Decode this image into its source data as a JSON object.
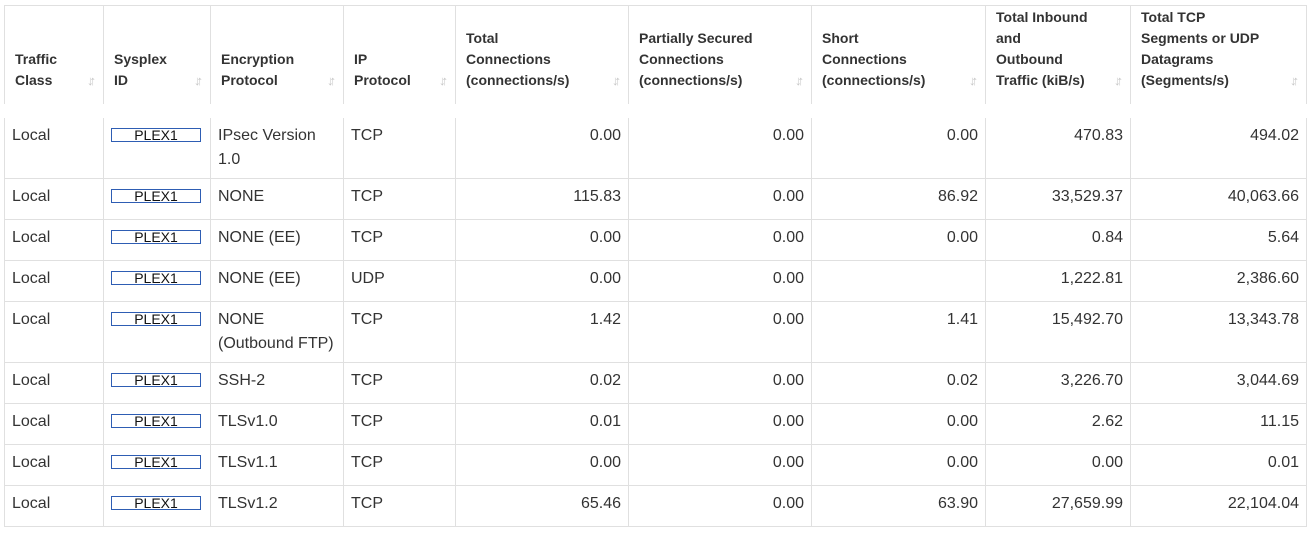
{
  "table": {
    "headers": [
      {
        "lines": [
          "Traffic",
          "Class"
        ]
      },
      {
        "lines": [
          "Sysplex",
          "ID"
        ]
      },
      {
        "lines": [
          "Encryption",
          "Protocol"
        ]
      },
      {
        "lines": [
          "IP",
          "Protocol"
        ]
      },
      {
        "lines": [
          "Total",
          "Connections",
          "(connections/s)"
        ]
      },
      {
        "lines": [
          "Partially Secured",
          "Connections",
          "(connections/s)"
        ]
      },
      {
        "lines": [
          "Short",
          "Connections",
          "(connections/s)"
        ]
      },
      {
        "lines": [
          "Total Inbound",
          "and",
          "Outbound",
          "Traffic (kiB/s)"
        ]
      },
      {
        "lines": [
          "Total TCP",
          "Segments or UDP",
          "Datagrams",
          "(Segments/s)"
        ]
      }
    ],
    "sort_icon": "sort-arrows-icon",
    "rows": [
      {
        "traffic_class": "Local",
        "sysplex": "PLEX1",
        "encryption": "IPsec Version 1.0",
        "ip_protocol": "TCP",
        "total_conn": "0.00",
        "partial_conn": "0.00",
        "short_conn": "0.00",
        "traffic": "470.83",
        "segments": "494.02"
      },
      {
        "traffic_class": "Local",
        "sysplex": "PLEX1",
        "encryption": "NONE",
        "ip_protocol": "TCP",
        "total_conn": "115.83",
        "partial_conn": "0.00",
        "short_conn": "86.92",
        "traffic": "33,529.37",
        "segments": "40,063.66"
      },
      {
        "traffic_class": "Local",
        "sysplex": "PLEX1",
        "encryption": "NONE (EE)",
        "ip_protocol": "TCP",
        "total_conn": "0.00",
        "partial_conn": "0.00",
        "short_conn": "0.00",
        "traffic": "0.84",
        "segments": "5.64"
      },
      {
        "traffic_class": "Local",
        "sysplex": "PLEX1",
        "encryption": "NONE (EE)",
        "ip_protocol": "UDP",
        "total_conn": "0.00",
        "partial_conn": "0.00",
        "short_conn": "",
        "traffic": "1,222.81",
        "segments": "2,386.60"
      },
      {
        "traffic_class": "Local",
        "sysplex": "PLEX1",
        "encryption": "NONE (Outbound FTP)",
        "ip_protocol": "TCP",
        "total_conn": "1.42",
        "partial_conn": "0.00",
        "short_conn": "1.41",
        "traffic": "15,492.70",
        "segments": "13,343.78"
      },
      {
        "traffic_class": "Local",
        "sysplex": "PLEX1",
        "encryption": "SSH-2",
        "ip_protocol": "TCP",
        "total_conn": "0.02",
        "partial_conn": "0.00",
        "short_conn": "0.02",
        "traffic": "3,226.70",
        "segments": "3,044.69"
      },
      {
        "traffic_class": "Local",
        "sysplex": "PLEX1",
        "encryption": "TLSv1.0",
        "ip_protocol": "TCP",
        "total_conn": "0.01",
        "partial_conn": "0.00",
        "short_conn": "0.00",
        "traffic": "2.62",
        "segments": "11.15"
      },
      {
        "traffic_class": "Local",
        "sysplex": "PLEX1",
        "encryption": "TLSv1.1",
        "ip_protocol": "TCP",
        "total_conn": "0.00",
        "partial_conn": "0.00",
        "short_conn": "0.00",
        "traffic": "0.00",
        "segments": "0.01"
      },
      {
        "traffic_class": "Local",
        "sysplex": "PLEX1",
        "encryption": "TLSv1.2",
        "ip_protocol": "TCP",
        "total_conn": "65.46",
        "partial_conn": "0.00",
        "short_conn": "63.90",
        "traffic": "27,659.99",
        "segments": "22,104.04"
      }
    ]
  }
}
